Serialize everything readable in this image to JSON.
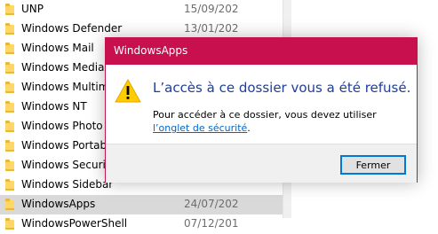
{
  "explorer": {
    "rows": [
      {
        "name": "UNP",
        "date": "15/09/202"
      },
      {
        "name": "Windows Defender",
        "date": "13/01/202"
      },
      {
        "name": "Windows Mail",
        "date": ""
      },
      {
        "name": "Windows Media P",
        "date": ""
      },
      {
        "name": "Windows Multime",
        "date": ""
      },
      {
        "name": "Windows NT",
        "date": ""
      },
      {
        "name": "Windows Photo V",
        "date": ""
      },
      {
        "name": "Windows Portable",
        "date": ""
      },
      {
        "name": "Windows Security",
        "date": ""
      },
      {
        "name": "Windows Sidebar",
        "date": ""
      },
      {
        "name": "WindowsApps",
        "date": "24/07/202"
      },
      {
        "name": "WindowsPowerShell",
        "date": "07/12/201"
      }
    ],
    "selected_index": 10
  },
  "dialog": {
    "title": "WindowsApps",
    "message": "L’accès à ce dossier vous a été refusé.",
    "detail_prefix": "Pour accéder à ce dossier, vous devez utiliser ",
    "detail_link": "l’onglet de sécurité",
    "detail_suffix": ".",
    "close_label": "Fermer",
    "accent_color": "#c8104e"
  }
}
